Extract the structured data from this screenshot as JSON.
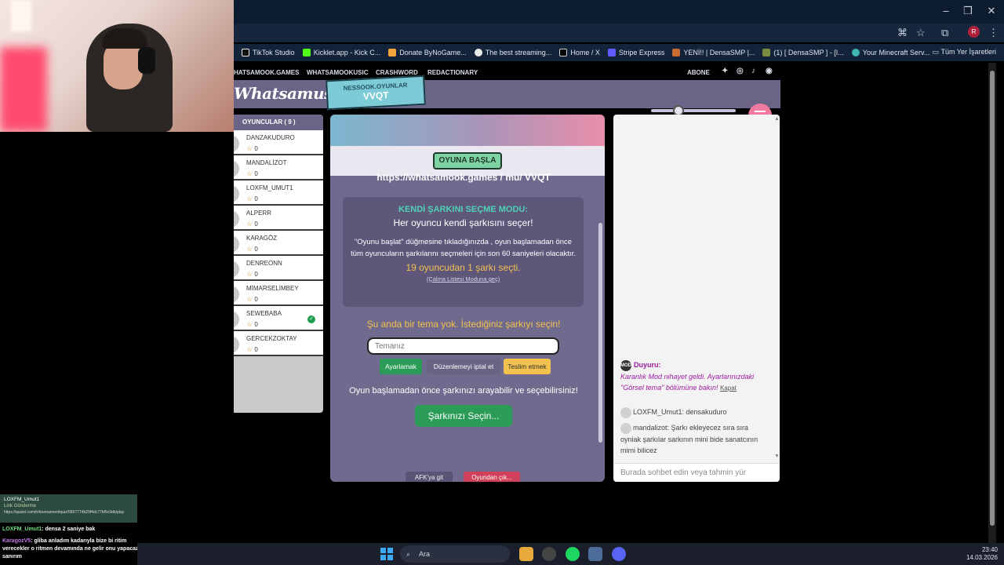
{
  "browser": {
    "bookmarks": [
      "TikTok Studio",
      "Kicklet.app - Kick C...",
      "Donate ByNoGame...",
      "The best streaming...",
      "Home / X",
      "Stripe Express",
      "YENİ!! | DensaSMP |...",
      "(1) [ DensaSMP ] - [I...",
      "Your Minecraft Serv..."
    ],
    "bookmarks_all": "Tüm Yer İşaretleri",
    "profile_initial": "R"
  },
  "site_nav": {
    "items": [
      "HATSAMOOK.GAMES",
      "WHATSAMOOKUSIC",
      "CRASHWORD",
      "REDACTIONARY"
    ],
    "subscribe": "ABONE"
  },
  "header": {
    "logo": "Whatsamusic",
    "room_badge_line1": "NESSOOK.OYUNLAR",
    "room_badge_line2": "VVQT"
  },
  "players": {
    "title": "OYUNCULAR ( 9 )",
    "list": [
      {
        "name": "DANZAKUDURO",
        "score": "0",
        "selected": false
      },
      {
        "name": "MANDALİZOT",
        "score": "0",
        "selected": false
      },
      {
        "name": "LOXFM_UMUT1",
        "score": "0",
        "selected": false
      },
      {
        "name": "ALPERR",
        "score": "0",
        "selected": false
      },
      {
        "name": "KARAGÖZ",
        "score": "0",
        "selected": false
      },
      {
        "name": "DENREONN",
        "score": "0",
        "selected": false
      },
      {
        "name": "MİMARSELİMBEY",
        "score": "0",
        "selected": false
      },
      {
        "name": "SEWEBABA",
        "score": "0",
        "selected": true
      },
      {
        "name": "GERCEKZOKTAY",
        "score": "0",
        "selected": false
      }
    ]
  },
  "game": {
    "start_label": "OYUNA BAŞLA",
    "room_url": "https://whatsamook.games / mu/ VVQT",
    "mode_title": "KENDİ ŞARKINI SEÇME MODU:",
    "mode_subtitle": "Her oyuncu kendi şarkısını seçer!",
    "mode_description": "\"Oyunu başlat\" düğmesine tıkladığınızda , oyun başlamadan önce tüm oyuncuların şarkılarını seçmeleri için son 60 saniyeleri olacaktır.",
    "mode_count": "19 oyuncudan 1 şarkı seçti.",
    "mode_link": "(Çalma Listesi Moduna geç)",
    "no_theme": "Şu anda bir tema yok. İstediğiniz şarkıyı seçin!",
    "theme_placeholder": "Temanız",
    "btn_set": "Ayarlamak",
    "btn_cancel": "Düzenlemeyi iptal et",
    "btn_submit": "Teslim etmek",
    "search_note": "Oyun başlamadan önce şarkınızı arayabilir ve seçebilirsiniz!",
    "choose_label": "Şarkınızı Seçin...",
    "afk_label": "AFK'ya git",
    "leave_label": "Oyundan çık..."
  },
  "chat": {
    "announce_title": "Duyuru:",
    "announce_body": "Karanlık Mod nihayet geldi. Ayarlarınızdaki \"Görsel tema\" bölümüne bakın!",
    "announce_close": "Kapat",
    "messages": [
      {
        "text": "LOXFM_Umut1: densakuduro"
      },
      {
        "text": "mandalizot: Şarkı ekleyecez sıra sıra oyniak şarkılar sarkının mini bide sanatcının mimi bilicez"
      }
    ],
    "input_placeholder": "Burada sohbet edin veya tahmin yür"
  },
  "overlay": {
    "user": "LOXFM_Umut1",
    "link_label": "Link Gönderme",
    "url": "https://quizel.com/tr/tournament/quiz/5897774b29f4dc77bf5c9db/play",
    "line1_user": "LOXFM_Umut1",
    "line1_text": ": densa 2 saniye bak",
    "line2_user": "KaragozV5",
    "line2_text": ": gliba anladım kadarıyla bize bi ritim verecekler o ritmen devamında ne gelir onu yapacaz sanırım"
  },
  "taskbar": {
    "search": "Ara",
    "time": "23:40",
    "date": "14.03.2026"
  }
}
